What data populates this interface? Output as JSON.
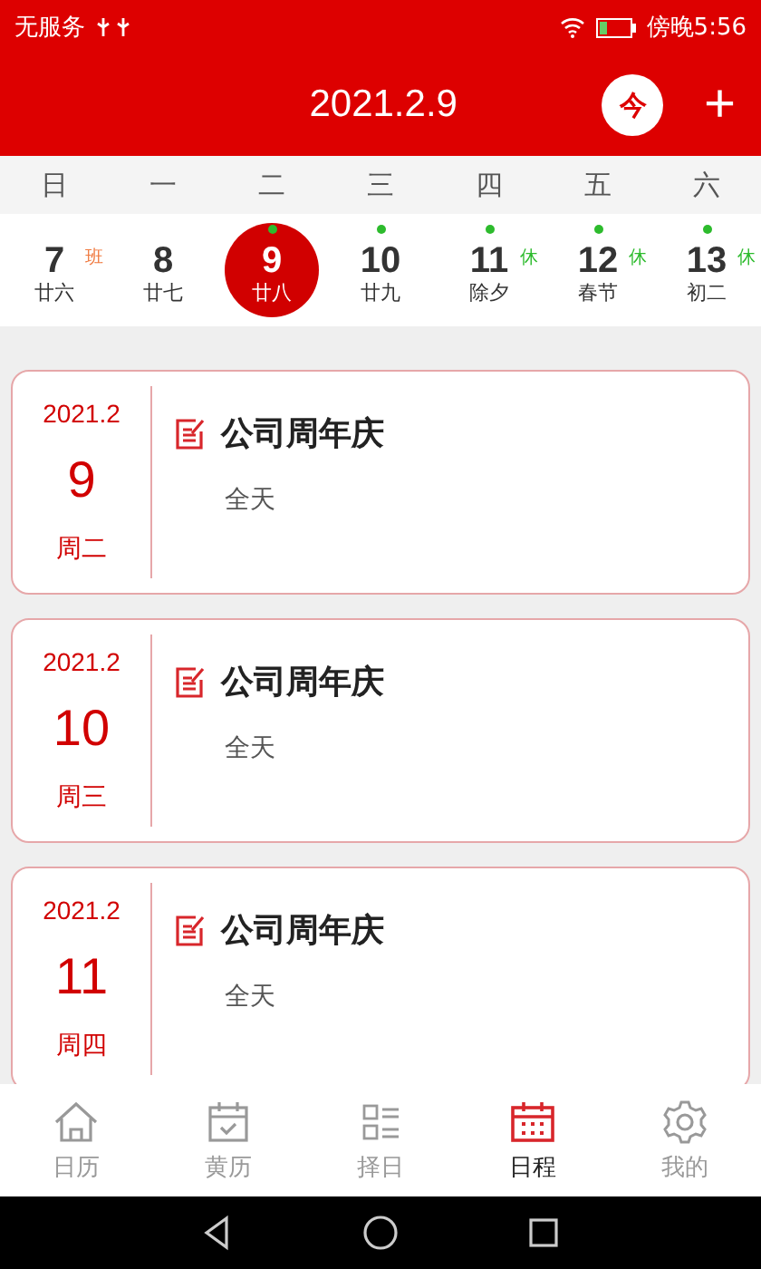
{
  "status_bar": {
    "carrier": "无服务",
    "time": "傍晚5:56"
  },
  "header": {
    "title": "2021.2.9",
    "today_button": "今",
    "add_button": "+"
  },
  "weekdays": [
    "日",
    "一",
    "二",
    "三",
    "四",
    "五",
    "六"
  ],
  "days": [
    {
      "day": "7",
      "lunar": "廿六",
      "badge": "班",
      "color": "#f07a40",
      "dot": false,
      "selected": false
    },
    {
      "day": "8",
      "lunar": "廿七",
      "dot": false,
      "selected": false
    },
    {
      "day": "9",
      "lunar": "廿八",
      "dot": true,
      "selected": true
    },
    {
      "day": "10",
      "lunar": "廿九",
      "dot": true,
      "selected": false
    },
    {
      "day": "11",
      "lunar": "除夕",
      "badge": "休",
      "color": "#2dbb2d",
      "dot": true,
      "selected": false
    },
    {
      "day": "12",
      "lunar": "春节",
      "badge": "休",
      "color": "#2dbb2d",
      "dot": true,
      "selected": false
    },
    {
      "day": "13",
      "lunar": "初二",
      "badge": "休",
      "color": "#2dbb2d",
      "dot": true,
      "selected": false
    }
  ],
  "events": [
    {
      "month": "2021.2",
      "day": "9",
      "weekday": "周二",
      "title": "公司周年庆",
      "time": "全天"
    },
    {
      "month": "2021.2",
      "day": "10",
      "weekday": "周三",
      "title": "公司周年庆",
      "time": "全天"
    },
    {
      "month": "2021.2",
      "day": "11",
      "weekday": "周四",
      "title": "公司周年庆",
      "time": "全天"
    }
  ],
  "tabs": [
    {
      "label": "日历",
      "kind": "home",
      "selected": false
    },
    {
      "label": "黄历",
      "kind": "almanac",
      "selected": false
    },
    {
      "label": "择日",
      "kind": "list",
      "selected": false
    },
    {
      "label": "日程",
      "kind": "schedule",
      "selected": true
    },
    {
      "label": "我的",
      "kind": "settings",
      "selected": false
    }
  ]
}
